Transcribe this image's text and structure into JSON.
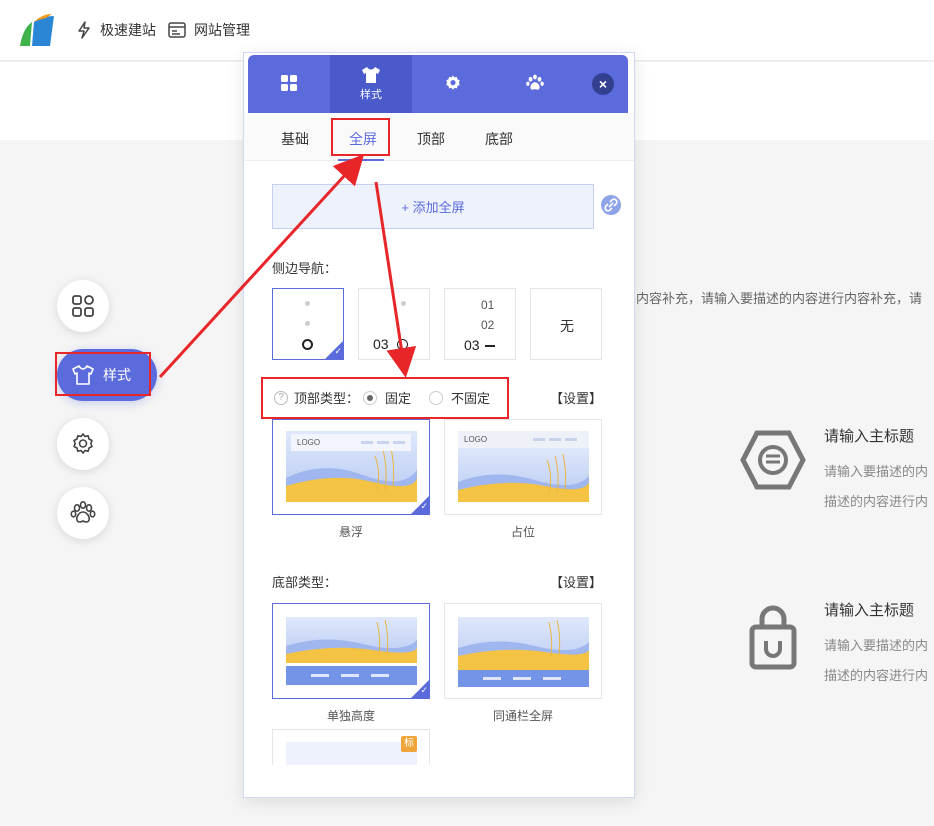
{
  "topbar": {
    "nav1_label": "极速建站",
    "nav2_label": "网站管理"
  },
  "left_toolbar": {
    "style_label": "样式"
  },
  "background": {
    "partial_text": "内容补充，请输入要描述的内容进行内容补充，请",
    "features": [
      {
        "title": "请输入主标题",
        "desc1": "请输入要描述的内",
        "desc2": "描述的内容进行内"
      },
      {
        "title": "请输入主标题",
        "desc1": "请输入要描述的内",
        "desc2": "描述的内容进行内"
      }
    ]
  },
  "panel": {
    "tabs": [
      {
        "label": "",
        "icon": "grid-icon"
      },
      {
        "label": "样式",
        "icon": "shirt-icon"
      },
      {
        "label": "",
        "icon": "gear-icon"
      },
      {
        "label": "",
        "icon": "paw-icon"
      }
    ],
    "close": "×",
    "subtabs": [
      "基础",
      "全屏",
      "顶部",
      "底部"
    ],
    "active_subtab": "全屏",
    "add_fullscreen": "+ 添加全屏",
    "sidenav_label": "侧边导航：",
    "sidenav_options": [
      {
        "text": "",
        "selected": true
      },
      {
        "text": "03",
        "selected": false
      },
      {
        "lines": [
          "01",
          "02",
          "03"
        ],
        "selected": false
      },
      {
        "text": "无",
        "selected": false
      }
    ],
    "top_type_label": "顶部类型：",
    "top_type_help": "?",
    "top_type_options": [
      "固定",
      "不固定"
    ],
    "top_type_selected": "固定",
    "top_settings": "【设置】",
    "top_thumbs": [
      {
        "caption": "悬浮",
        "logo": "LOGO",
        "selected": true
      },
      {
        "caption": "占位",
        "logo": "LOGO",
        "selected": false
      }
    ],
    "bottom_type_label": "底部类型：",
    "bottom_settings": "【设置】",
    "bottom_thumbs": [
      {
        "caption": "单独高度",
        "selected": true
      },
      {
        "caption": "同通栏全屏",
        "selected": false
      }
    ],
    "third_badge": "标"
  },
  "colors": {
    "accent": "#5b6bdc",
    "annotation_red": "#e8262a"
  }
}
